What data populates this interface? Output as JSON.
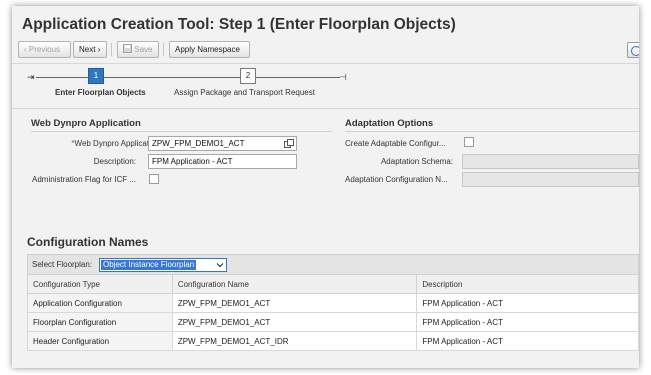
{
  "page": {
    "title": "Application Creation Tool: Step 1  (Enter Floorplan Objects)"
  },
  "toolbar": {
    "previous_label": "Previous",
    "next_label": "Next",
    "save_label": "Save",
    "apply_namespace_label": "Apply Namespace"
  },
  "roadmap": {
    "steps": [
      {
        "number": "1",
        "label": "Enter Floorplan Objects",
        "state": "active"
      },
      {
        "number": "2",
        "label": "Assign Package and Transport Request",
        "state": "inactive"
      }
    ]
  },
  "web_dynpro": {
    "heading": "Web Dynpro Application",
    "app_label": "Web Dynpro Application:",
    "app_value": "ZPW_FPM_DEMO1_ACT",
    "description_label": "Description:",
    "description_value": "FPM Application - ACT",
    "admin_flag_label": "Administration Flag for ICF ...",
    "admin_flag_checked": false
  },
  "adaptation": {
    "heading": "Adaptation Options",
    "create_label": "Create Adaptable Configur...",
    "create_checked": false,
    "schema_label": "Adaptation Schema:",
    "schema_value": "",
    "config_name_label": "Adaptation Configuration N...",
    "config_name_value": ""
  },
  "configuration": {
    "heading": "Configuration Names",
    "floorplan_label": "Select Floorplan:",
    "floorplan_value": "Object Instance Floorplan",
    "columns": [
      "Configuration Type",
      "Configuration Name",
      "Description"
    ],
    "rows": [
      [
        "Application Configuration",
        "ZPW_FPM_DEMO1_ACT",
        "FPM Application - ACT"
      ],
      [
        "Floorplan Configuration",
        "ZPW_FPM_DEMO1_ACT",
        "FPM Application - ACT"
      ],
      [
        "Header Configuration",
        "ZPW_FPM_DEMO1_ACT_IDR",
        "FPM Application - ACT"
      ]
    ]
  },
  "icons": {
    "previous": "chevron-left-icon",
    "next": "chevron-right-icon",
    "save": "floppy-disk-icon",
    "value_help": "value-help-icon",
    "dropdown": "chevron-down-icon",
    "help": "help-icon"
  },
  "colors": {
    "accent": "#2e78bf",
    "selection": "#3875d7",
    "background": "#f2f2f2"
  }
}
